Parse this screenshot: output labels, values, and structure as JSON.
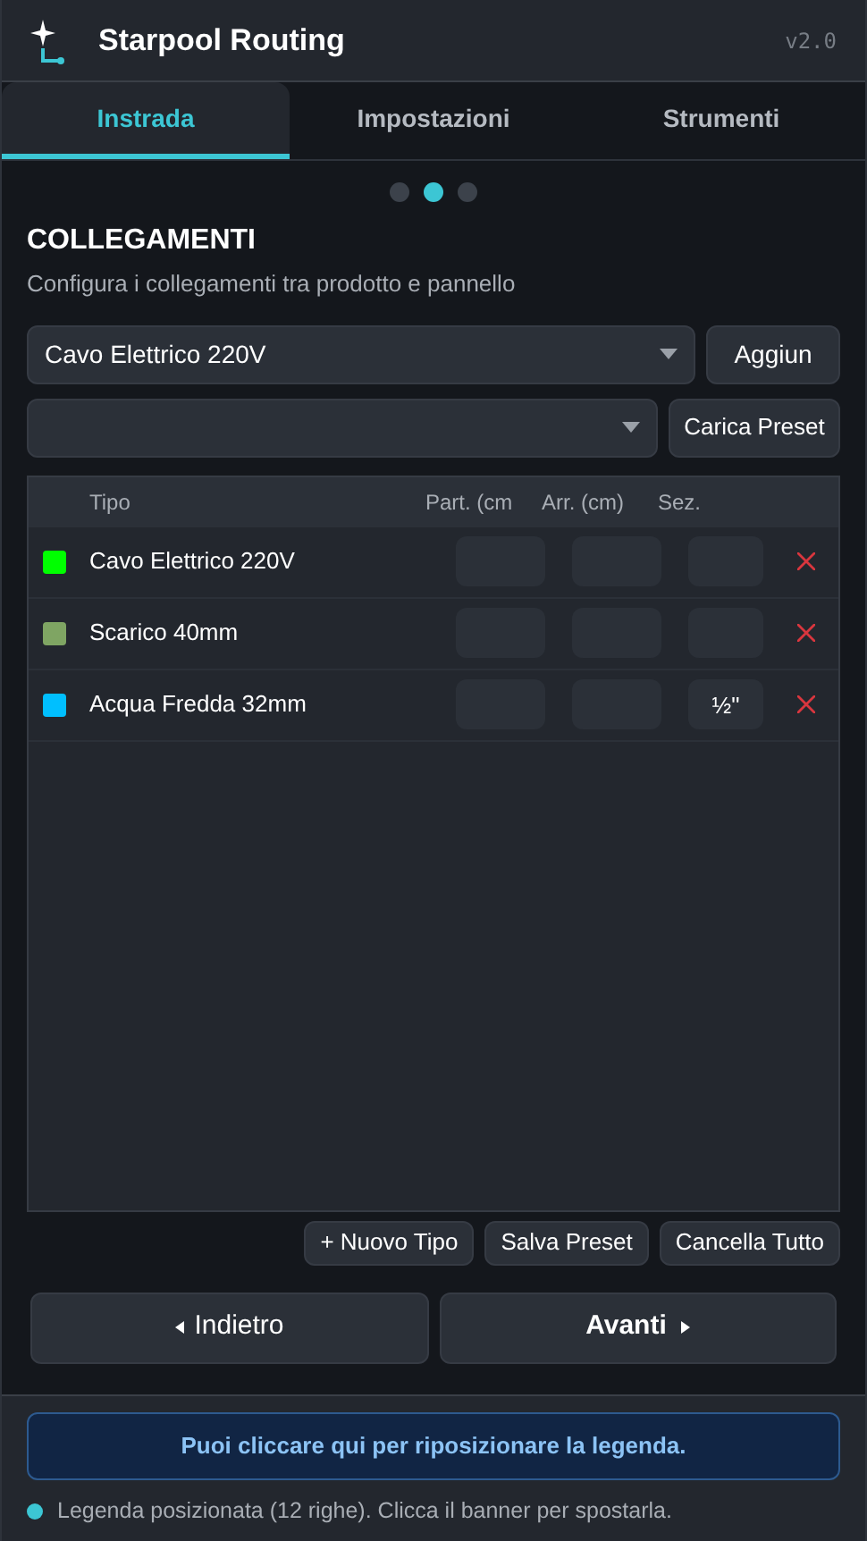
{
  "header": {
    "title": "Starpool Routing",
    "version": "v2.0"
  },
  "tabs": [
    {
      "label": "Instrada",
      "selected": true
    },
    {
      "label": "Impostazioni",
      "selected": false
    },
    {
      "label": "Strumenti",
      "selected": false
    }
  ],
  "steps": [
    {
      "selected": false
    },
    {
      "selected": true
    },
    {
      "selected": false
    }
  ],
  "section": {
    "title": "COLLEGAMENTI",
    "subtitle": "Configura i collegamenti tra prodotto e pannello"
  },
  "type_select": {
    "value": "Cavo Elettrico 220V"
  },
  "add_button": "Aggiun",
  "load_preset_button": "Carica Preset",
  "table": {
    "columns": [
      "Tipo",
      "Part. (cm",
      "Arr. (cm)",
      "Sez."
    ],
    "rows": [
      {
        "color": "#00ff00",
        "type": "Cavo Elettrico 220V",
        "start": "",
        "end": "",
        "section": ""
      },
      {
        "color": "#7fa563",
        "type": "Scarico 40mm",
        "start": "",
        "end": "",
        "section": ""
      },
      {
        "color": "#00bfff",
        "type": "Acqua Fredda 32mm",
        "start": "",
        "end": "",
        "section": "½\""
      }
    ]
  },
  "actions": [
    "+ Nuovo Tipo",
    "Salva Preset",
    "Cancella Tutto"
  ],
  "nav": {
    "back": "Indietro",
    "next": "Avanti"
  },
  "footer": {
    "banner": "Puoi cliccare qui per riposizionare la legenda.",
    "status": "Legenda posizionata (12 righe). Clicca il banner per spostarla."
  }
}
